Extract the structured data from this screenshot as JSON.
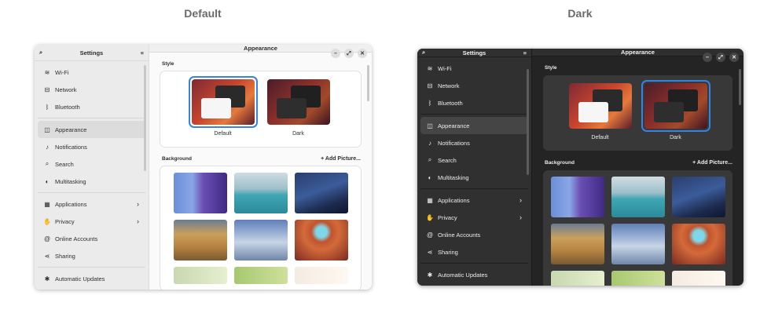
{
  "captions": {
    "left": "Default",
    "right": "Dark"
  },
  "sidebar": {
    "title": "Settings",
    "items": [
      {
        "label": "Wi-Fi",
        "icon": "wifi-icon",
        "glyph": "≋"
      },
      {
        "label": "Network",
        "icon": "network-icon",
        "glyph": "⊟"
      },
      {
        "label": "Bluetooth",
        "icon": "bluetooth-icon",
        "glyph": "ᛒ"
      },
      {
        "label": "Appearance",
        "icon": "appearance-icon",
        "glyph": "◫"
      },
      {
        "label": "Notifications",
        "icon": "bell-icon",
        "glyph": "♪"
      },
      {
        "label": "Search",
        "icon": "search-icon",
        "glyph": "⌕"
      },
      {
        "label": "Multitasking",
        "icon": "multitasking-icon",
        "glyph": "◐"
      },
      {
        "label": "Applications",
        "icon": "applications-icon",
        "glyph": "▦"
      },
      {
        "label": "Privacy",
        "icon": "privacy-icon",
        "glyph": "✋"
      },
      {
        "label": "Online Accounts",
        "icon": "online-accounts-icon",
        "glyph": "@"
      },
      {
        "label": "Sharing",
        "icon": "sharing-icon",
        "glyph": "⋖"
      },
      {
        "label": "Automatic Updates",
        "icon": "updates-icon",
        "glyph": "✱"
      }
    ]
  },
  "main": {
    "title": "Appearance",
    "style_section": "Style",
    "style_options": {
      "default": "Default",
      "dark": "Dark"
    },
    "background_section": "Background",
    "add_picture": "+ Add Picture..."
  },
  "colors": {
    "accent": "#3584e4"
  }
}
